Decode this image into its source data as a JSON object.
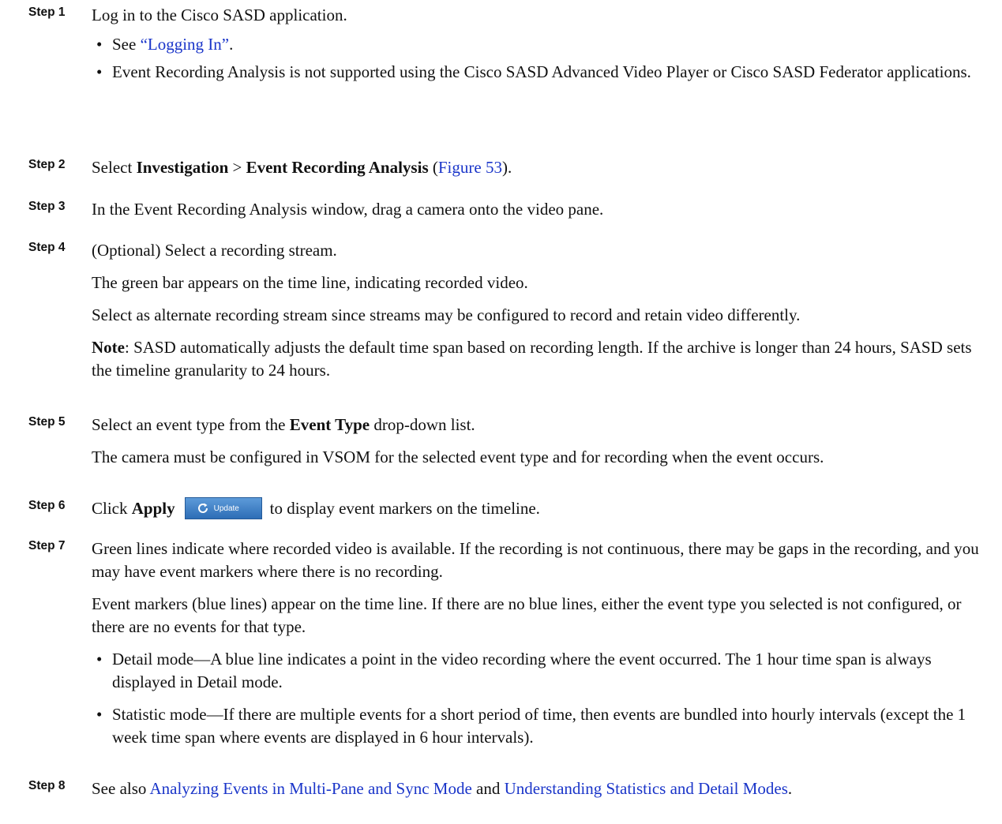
{
  "steps": [
    {
      "label": "Step 1",
      "text": "Log in to the Cisco SASD application.",
      "bullets": [
        {
          "pre": "See ",
          "link": "“Logging In”",
          "post": "."
        },
        {
          "text": "Event Recording Analysis is not supported using the Cisco SASD Advanced Video Player or Cisco SASD Federator applications."
        }
      ]
    },
    {
      "label": "Step 2",
      "pre": "Select ",
      "b1": "Investigation",
      "mid": " > ",
      "b2": "Event Recording Analysis",
      "sp": " (",
      "link": "Figure 53",
      "post": ")."
    },
    {
      "label": "Step 3",
      "text": "In the Event Recording Analysis window, drag a camera onto the video pane."
    },
    {
      "label": "Step 4",
      "text": "(Optional) Select a recording stream.",
      "p1": "The green bar appears on the time line, indicating recorded video.",
      "p2": "Select as alternate recording stream since streams may be configured to record and retain video differently.",
      "note_label": "Note",
      "note": ": SASD automatically adjusts the default time span based on recording length. If the archive is longer than 24 hours, SASD sets the timeline granularity to 24 hours."
    },
    {
      "label": "Step 5",
      "pre": "Select an event type from the ",
      "bold": "Event Type",
      "post": " drop-down list.",
      "p1": "The camera must be configured in VSOM for the selected event type and for recording when the event occurs."
    },
    {
      "label": "Step 6",
      "pre": "Click ",
      "bold": "Apply",
      "button": "Update",
      "post": "to display event markers on the timeline."
    },
    {
      "label": "Step 7",
      "text": "Green lines indicate where recorded video is available. If the recording is not continuous, there may be gaps in the recording, and you may have event markers where there is no recording.",
      "p1": "Event markers (blue lines) appear on the time line. If there are no blue lines, either the event type you selected is not configured, or there are no events for that type.",
      "bullets": [
        "Detail mode—A blue line indicates a point in the video recording where the event occurred. The 1 hour time span is always displayed in Detail mode.",
        "Statistic mode—If there are multiple events for a short period of time, then events are bundled into hourly intervals (except the 1 week time span where events are displayed in 6 hour intervals)."
      ]
    },
    {
      "label": "Step 8",
      "pre": "See also ",
      "link1": "Analyzing Events in Multi-Pane and Sync Mode",
      "mid": " and ",
      "link2": "Understanding Statistics and Detail Modes",
      "post": "."
    }
  ],
  "colors": {
    "link": "#1a35c9",
    "button": "#3a7cc4"
  }
}
